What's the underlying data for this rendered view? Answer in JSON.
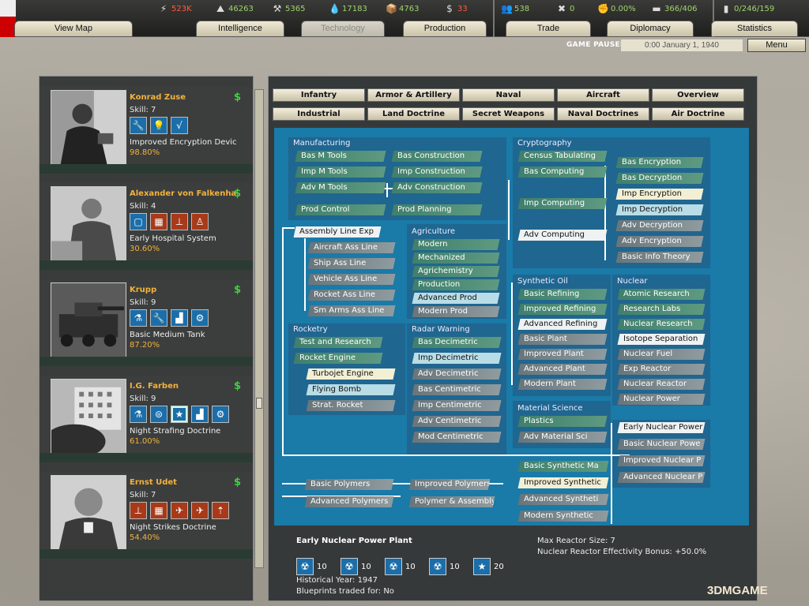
{
  "resources": [
    {
      "icon": "energy-icon",
      "value": "523K",
      "red": true
    },
    {
      "icon": "metal-icon",
      "value": "46263"
    },
    {
      "icon": "rare-materials-icon",
      "value": "5365"
    },
    {
      "icon": "oil-icon",
      "value": "17183"
    },
    {
      "icon": "supplies-icon",
      "value": "4763"
    },
    {
      "icon": "money-icon",
      "value": "33",
      "red": true
    },
    {
      "icon": "manpower-icon",
      "value": "538"
    },
    {
      "icon": "transports-icon",
      "value": "0"
    },
    {
      "icon": "dissent-icon",
      "value": "0.00%"
    },
    {
      "icon": "ic-icon",
      "value": "366/406"
    },
    {
      "icon": "divisions-icon",
      "value": "0/246/159"
    }
  ],
  "tabs": [
    "View Map",
    "Intelligence",
    "Technology",
    "Production",
    "Trade",
    "Diplomacy",
    "Statistics"
  ],
  "status": {
    "paused": "GAME PAUSED",
    "date": "0:00 January 1, 1940",
    "menu": "Menu"
  },
  "teams": [
    {
      "name": "Konrad Zuse",
      "skill": "Skill: 7",
      "project": "Improved Encryption Devic",
      "pct": "98.80%",
      "icons": [
        "wrench-icon",
        "bulb-icon",
        "math-icon"
      ]
    },
    {
      "name": "Alexander von Falkenha",
      "skill": "Skill: 4",
      "project": "Early Hospital System",
      "pct": "30.60%",
      "icons": [
        "document-icon",
        "doctrine-icon",
        "organisation-icon",
        "infantry-icon"
      ]
    },
    {
      "name": "Krupp",
      "skill": "Skill: 9",
      "project": "Basic Medium Tank",
      "pct": "87.20%",
      "icons": [
        "flask-icon",
        "wrench-icon",
        "factory-icon",
        "gear-icon"
      ]
    },
    {
      "name": "I.G. Farben",
      "skill": "Skill: 9",
      "project": "Night Strafing Doctrine",
      "pct": "61.00%",
      "icons": [
        "flask-icon",
        "chemistry-icon",
        "star-icon",
        "factory-icon",
        "gear-icon"
      ]
    },
    {
      "name": "Ernst Udet",
      "skill": "Skill: 7",
      "project": "Night Strikes Doctrine",
      "pct": "54.40%",
      "icons": [
        "organisation-icon",
        "doctrine-icon",
        "aircraft-icon",
        "plane-icon",
        "rocket-icon"
      ]
    }
  ],
  "categories": [
    "Infantry",
    "Armor & Artillery",
    "Naval",
    "Aircraft",
    "Overview",
    "Industrial",
    "Land Doctrine",
    "Secret Weapons",
    "Naval Doctrines",
    "Air Doctrine"
  ],
  "tree": {
    "sections": [
      "Manufacturing",
      "Agriculture",
      "Rocketry",
      "Radar Warning",
      "Cryptography",
      "Synthetic Oil",
      "Nuclear",
      "Material Science"
    ],
    "techs": [
      "Bas M Tools",
      "Bas Construction",
      "Imp M Tools",
      "Imp Construction",
      "Adv M Tools",
      "Adv Construction",
      "Prod Control",
      "Prod Planning",
      "Assembly Line Exp",
      "Aircraft Ass Line",
      "Ship Ass Line",
      "Vehicle Ass Line",
      "Rocket Ass Line",
      "Sm Arms Ass Line",
      "Modern",
      "Mechanized",
      "Agrichemistry",
      "Production",
      "Advanced Prod",
      "Modern Prod",
      "Test and Research",
      "Rocket Engine",
      "Turbojet Engine",
      "Flying Bomb",
      "Strat. Rocket",
      "Bas Decimetric",
      "Imp Decimetric",
      "Adv Decimetric",
      "Bas Centimetric",
      "Imp Centimetric",
      "Adv Centimetric",
      "Mod Centimetric",
      "Basic Polymers",
      "Improved Polymers",
      "Advanced Polymers",
      "Polymer & Assembly",
      "Census Tabulating",
      "Bas Computing",
      "Bas Encryption",
      "Bas Decryption",
      "Imp Computing",
      "Imp Encryption",
      "Imp Decryption",
      "Adv Computing",
      "Adv Decryption",
      "Adv Encryption",
      "Basic Info Theory",
      "Basic Refining",
      "Improved Refining",
      "Advanced Refining",
      "Basic Plant",
      "Improved Plant",
      "Advanced Plant",
      "Modern Plant",
      "Atomic Research",
      "Research Labs",
      "Nuclear Research",
      "Isotope Separation",
      "Nuclear Fuel",
      "Exp Reactor",
      "Nuclear Reactor",
      "Nuclear Power",
      "Plastics",
      "Adv Material Sci",
      "Early Nuclear Power",
      "Basic Nuclear Powe",
      "Improved Nuclear P",
      "Advanced Nuclear P",
      "Basic Synthetic Ma",
      "Improved Synthetic",
      "Advanced Syntheti",
      "Modern Synthetic"
    ]
  },
  "info": {
    "title": "Early Nuclear Power Plant",
    "reqs": [
      {
        "icon": "nuclear-icon",
        "v": "10"
      },
      {
        "icon": "nuclear-icon",
        "v": "10"
      },
      {
        "icon": "nuclear-icon",
        "v": "10"
      },
      {
        "icon": "nuclear-icon",
        "v": "10"
      },
      {
        "icon": "star-icon",
        "v": "20"
      }
    ],
    "year": "Historical Year: 1947",
    "blueprints": "Blueprints traded for: No",
    "reactor": "Max Reactor Size: 7",
    "bonus": "Nuclear Reactor Effectivity Bonus: +50.0%"
  },
  "watermark": "3DMGAME"
}
